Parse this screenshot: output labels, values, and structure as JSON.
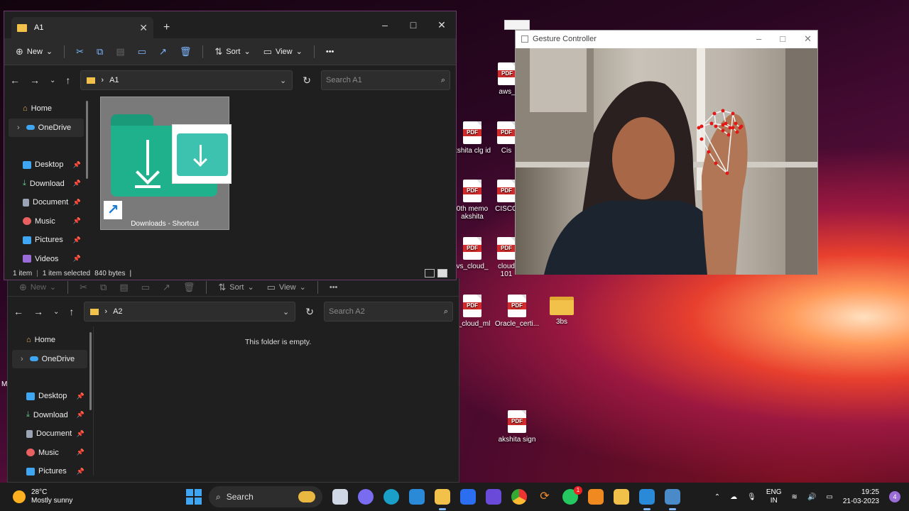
{
  "desktop": {
    "icons": [
      {
        "label": "aws_"
      },
      {
        "label": "kshita clg id"
      },
      {
        "label": "Cis"
      },
      {
        "label": "0th memo akshita"
      },
      {
        "label": "CISCO"
      },
      {
        "label": "vs_cloud_"
      },
      {
        "label": "cloud 101"
      },
      {
        "label": "s_cloud_ml"
      },
      {
        "label": "Oracle_certi..."
      },
      {
        "label": "3bs"
      },
      {
        "label": "akshita sign"
      }
    ],
    "pdf_badge": "PDF",
    "edge_letter": "M"
  },
  "explorer_top": {
    "tab_title": "A1",
    "new_tab": "+",
    "toolbar": {
      "new_label": "New",
      "sort_label": "Sort",
      "view_label": "View",
      "more": "•••"
    },
    "address": {
      "folder": "A1"
    },
    "search_placeholder": "Search A1",
    "sidebar": [
      {
        "label": "Home",
        "icon": "home-icon"
      },
      {
        "label": "OneDrive",
        "icon": "onedrive-icon"
      },
      {
        "label": "Desktop",
        "icon": "desktop-icon"
      },
      {
        "label": "Download",
        "icon": "download-icon"
      },
      {
        "label": "Document",
        "icon": "document-icon"
      },
      {
        "label": "Music",
        "icon": "music-icon"
      },
      {
        "label": "Pictures",
        "icon": "pictures-icon"
      },
      {
        "label": "Videos",
        "icon": "videos-icon"
      }
    ],
    "file": {
      "name": "Downloads - Shortcut"
    },
    "status": {
      "count": "1 item",
      "selected": "1 item selected",
      "size": "840 bytes"
    }
  },
  "explorer_bottom": {
    "toolbar": {
      "new_label": "New",
      "sort_label": "Sort",
      "view_label": "View",
      "more": "•••"
    },
    "address": {
      "folder": "A2"
    },
    "search_placeholder": "Search A2",
    "empty_message": "This folder is empty.",
    "sidebar": [
      {
        "label": "Home"
      },
      {
        "label": "OneDrive"
      },
      {
        "label": "Desktop"
      },
      {
        "label": "Download"
      },
      {
        "label": "Document"
      },
      {
        "label": "Music"
      },
      {
        "label": "Pictures"
      }
    ]
  },
  "gesture_window": {
    "title": "Gesture Controller"
  },
  "taskbar": {
    "weather": {
      "temp": "28°C",
      "desc": "Mostly sunny"
    },
    "search_label": "Search",
    "whatsapp_badge": "1",
    "lang": {
      "line1": "ENG",
      "line2": "IN"
    },
    "clock": {
      "time": "19:25",
      "date": "21-03-2023"
    },
    "notification_count": "4"
  },
  "colors": {
    "accent": "#7eb6ff",
    "folder": "#f2c14a",
    "pdf_red": "#d42b2b",
    "landmark": "#e01818"
  }
}
